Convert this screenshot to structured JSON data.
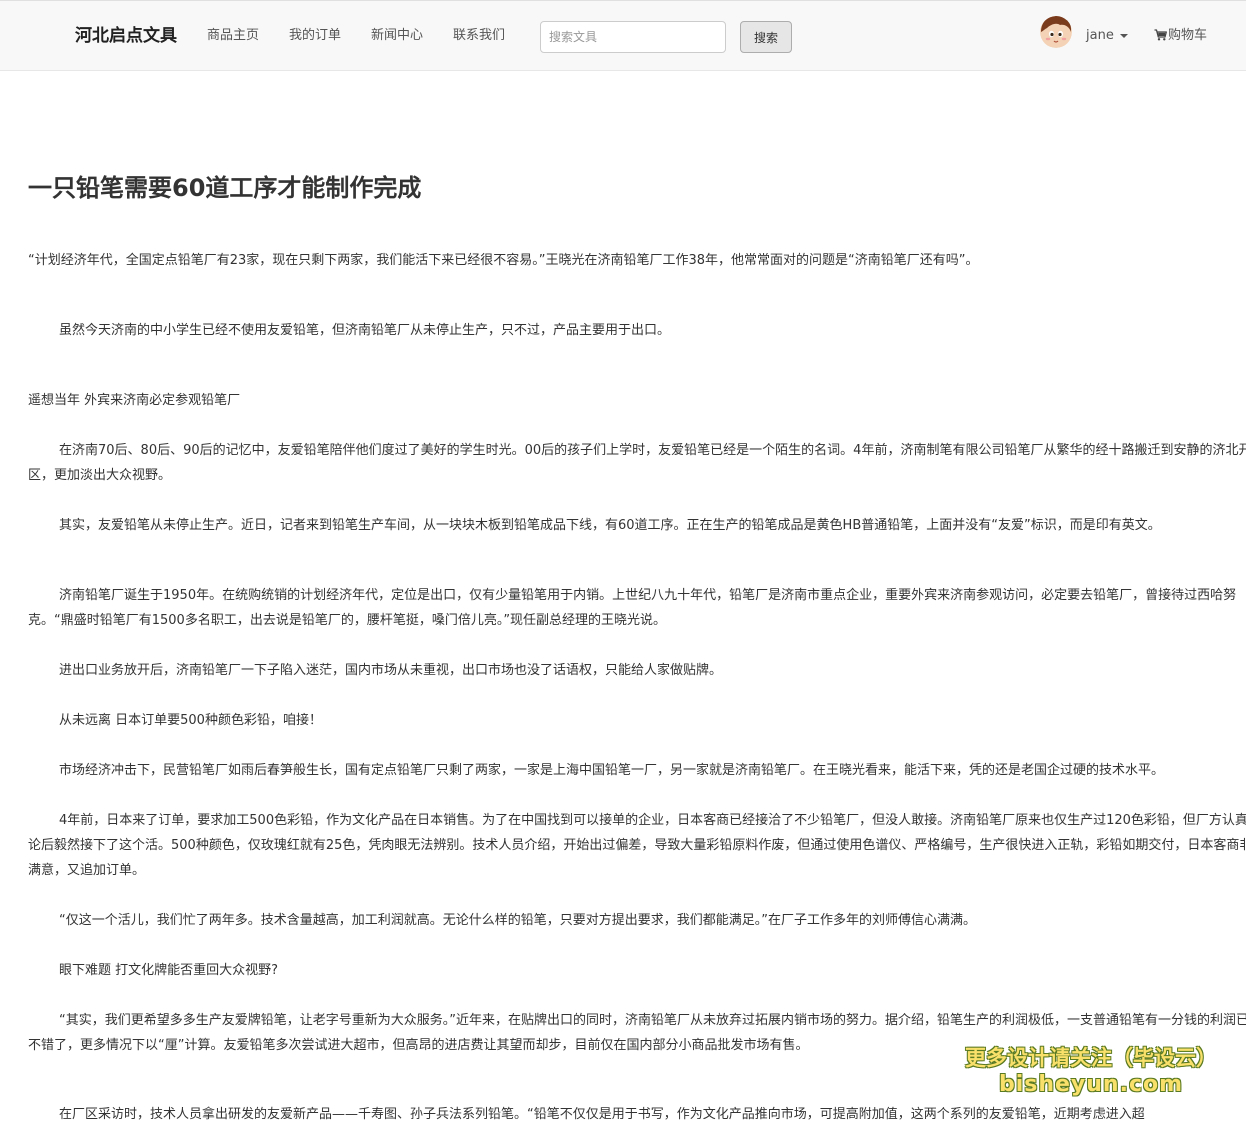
{
  "navbar": {
    "brand": "河北启点文具",
    "links": [
      "商品主页",
      "我的订单",
      "新闻中心",
      "联系我们"
    ],
    "search_placeholder": "搜索文具",
    "search_button": "搜索",
    "user_name": "jane",
    "cart_label": "购物车"
  },
  "article": {
    "title": "一只铅笔需要60道工序才能制作完成",
    "paragraphs": [
      "“计划经济年代，全国定点铅笔厂有23家，现在只剩下两家，我们能活下来已经很不容易。”王晓光在济南铅笔厂工作38年，他常常面对的问题是“济南铅笔厂还有吗”。",
      "虽然今天济南的中小学生已经不使用友爱铅笔，但济南铅笔厂从未停止生产，只不过，产品主要用于出口。",
      "遥想当年 外宾来济南必定参观铅笔厂",
      "在济南70后、80后、90后的记忆中，友爱铅笔陪伴他们度过了美好的学生时光。00后的孩子们上学时，友爱铅笔已经是一个陌生的名词。4年前，济南制笔有限公司铅笔厂从繁华的经十路搬迁到安静的济北开发区，更加淡出大众视野。",
      "其实，友爱铅笔从未停止生产。近日，记者来到铅笔生产车间，从一块块木板到铅笔成品下线，有60道工序。正在生产的铅笔成品是黄色HB普通铅笔，上面并没有“友爱”标识，而是印有英文。",
      "济南铅笔厂诞生于1950年。在统购统销的计划经济年代，定位是出口，仅有少量铅笔用于内销。上世纪八九十年代，铅笔厂是济南市重点企业，重要外宾来济南参观访问，必定要去铅笔厂，曾接待过西哈努克。“鼎盛时铅笔厂有1500多名职工，出去说是铅笔厂的，腰杆笔挺，嗓门倍儿亮。”现任副总经理的王晓光说。",
      "进出口业务放开后，济南铅笔厂一下子陷入迷茫，国内市场从未重视，出口市场也没了话语权，只能给人家做贴牌。",
      "从未远离 日本订单要500种颜色彩铅，咱接！",
      "市场经济冲击下，民营铅笔厂如雨后春笋般生长，国有定点铅笔厂只剩了两家，一家是上海中国铅笔一厂，另一家就是济南铅笔厂。在王晓光看来，能活下来，凭的还是老国企过硬的技术水平。",
      "4年前，日本来了订单，要求加工500色彩铅，作为文化产品在日本销售。为了在中国找到可以接单的企业，日本客商已经接洽了不少铅笔厂，但没人敢接。济南铅笔厂原来也仅生产过120色彩铅，但厂方认真讨论后毅然接下了这个活。500种颜色，仅玫瑰红就有25色，凭肉眼无法辨别。技术人员介绍，开始出过偏差，导致大量彩铅原料作废，但通过使用色谱仪、严格编号，生产很快进入正轨，彩铅如期交付，日本客商非常满意，又追加订单。",
      "“仅这一个活儿，我们忙了两年多。技术含量越高，加工利润就高。无论什么样的铅笔，只要对方提出要求，我们都能满足。”在厂子工作多年的刘师傅信心满满。",
      "眼下难题 打文化牌能否重回大众视野?",
      "“其实，我们更希望多多生产友爱牌铅笔，让老字号重新为大众服务。”近年来，在贴牌出口的同时，济南铅笔厂从未放弃过拓展内销市场的努力。据介绍，铅笔生产的利润极低，一支普通铅笔有一分钱的利润已经不错了，更多情况下以“厘”计算。友爱铅笔多次尝试进大超市，但高昂的进店费让其望而却步，目前仅在国内部分小商品批发市场有售。",
      "在厂区采访时，技术人员拿出研发的友爱新产品——千寿图、孙子兵法系列铅笔。“铅笔不仅仅是用于书写，作为文化产品推向市场，可提高附加值，这两个系列的友爱铅笔，近期考虑进入超"
    ]
  },
  "watermark": {
    "line1": "更多设计请关注（毕设云）",
    "line2": "bisheyun.com"
  }
}
